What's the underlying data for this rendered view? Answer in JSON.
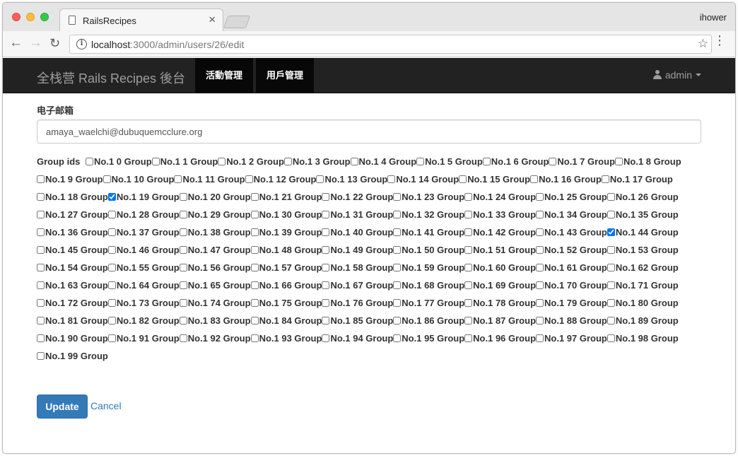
{
  "browser": {
    "tab_title": "RailsRecipes",
    "tab_close": "×",
    "profile": "ihower",
    "url_host": "localhost",
    "url_path": ":3000/admin/users/26/edit",
    "back": "←",
    "forward": "→",
    "reload": "↻",
    "star": "☆",
    "menu": "⋮"
  },
  "navbar": {
    "brand": "全栈营 Rails Recipes 後台",
    "items": [
      {
        "label": "活動管理",
        "active": true
      },
      {
        "label": "用戶管理",
        "active": true
      }
    ],
    "user": "admin"
  },
  "form": {
    "email_label": "电子邮箱",
    "email_value": "amaya_waelchi@dubuquemcclure.org",
    "group_ids_label": "Group ids",
    "group_prefix": "No.1",
    "group_suffix": "Group",
    "group_count": 100,
    "checked_groups": [
      19,
      44
    ],
    "submit": "Update",
    "cancel": "Cancel"
  },
  "colors": {
    "navbar_bg": "#222222",
    "navbar_active_bg": "#080808",
    "primary": "#337ab7"
  },
  "icons": [
    "document-icon",
    "close-icon",
    "back-arrow-icon",
    "forward-arrow-icon",
    "reload-icon",
    "info-icon",
    "star-icon",
    "menu-icon",
    "user-icon",
    "caret-down-icon"
  ]
}
